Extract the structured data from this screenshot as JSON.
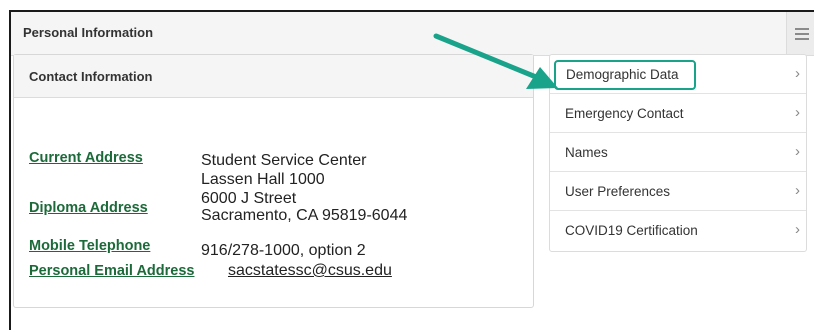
{
  "header": {
    "title": "Personal Information"
  },
  "contact": {
    "title": "Contact Information",
    "current_address_label": "Current Address",
    "diploma_address_label": "Diploma Address",
    "address_lines": [
      "Student Service Center",
      "Lassen Hall 1000",
      "6000 J Street",
      "Sacramento, CA 95819-6044"
    ],
    "mobile_label": "Mobile Telephone",
    "mobile_value": "916/278-1000, option 2",
    "email_label": "Personal Email Address",
    "email_value": "sacstatessc@csus.edu"
  },
  "nav": {
    "items": [
      {
        "label": "Demographic Data"
      },
      {
        "label": "Emergency Contact"
      },
      {
        "label": "Names"
      },
      {
        "label": "User Preferences"
      },
      {
        "label": "COVID19 Certification"
      }
    ],
    "chevron": "›"
  },
  "colors": {
    "link": "#1c6a3a",
    "highlight": "#19a38a"
  }
}
